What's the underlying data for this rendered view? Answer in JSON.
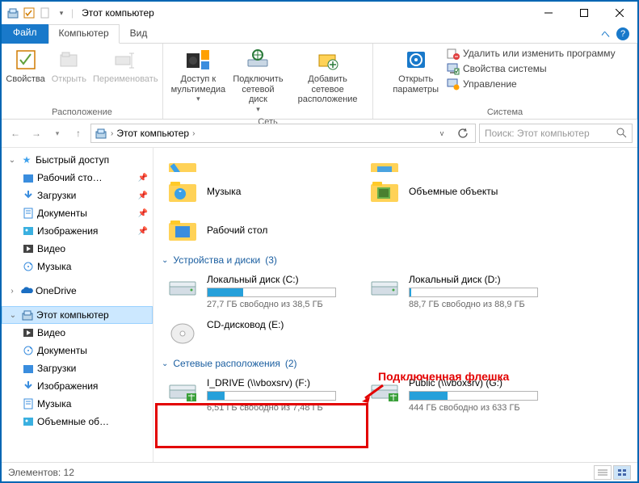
{
  "title": "Этот компьютер",
  "tabs": {
    "file": "Файл",
    "computer": "Компьютер",
    "view": "Вид"
  },
  "ribbon": {
    "group1": {
      "label": "Расположение",
      "props": "Свойства",
      "open": "Открыть",
      "rename": "Переименовать"
    },
    "group2": {
      "label": "Сеть",
      "media": "Доступ к\nмультимедиа",
      "netdrive": "Подключить\nсетевой диск",
      "addnet": "Добавить сетевое\nрасположение"
    },
    "group3": {
      "label": "Система",
      "settings": "Открыть\nпараметры",
      "uninstall": "Удалить или изменить программу",
      "sysprops": "Свойства системы",
      "manage": "Управление"
    }
  },
  "address": {
    "segment": "Этот компьютер"
  },
  "search": {
    "placeholder": "Поиск: Этот компьютер"
  },
  "tree": {
    "quick": "Быстрый доступ",
    "items1": [
      {
        "label": "Рабочий сто…",
        "pin": true
      },
      {
        "label": "Загрузки",
        "pin": true
      },
      {
        "label": "Документы",
        "pin": true
      },
      {
        "label": "Изображения",
        "pin": true
      },
      {
        "label": "Видео",
        "pin": false
      },
      {
        "label": "Музыка",
        "pin": false
      }
    ],
    "onedrive": "OneDrive",
    "thispc": "Этот компьютер",
    "items2": [
      {
        "label": "Видео"
      },
      {
        "label": "Документы"
      },
      {
        "label": "Загрузки"
      },
      {
        "label": "Изображения"
      },
      {
        "label": "Музыка"
      },
      {
        "label": "Объемные об…"
      }
    ]
  },
  "folders": {
    "row_partial": [
      {
        "name": ""
      },
      {
        "name": ""
      }
    ],
    "row1": [
      {
        "name": "Музыка"
      },
      {
        "name": "Объемные объекты"
      }
    ],
    "row2": [
      {
        "name": "Рабочий стол"
      }
    ]
  },
  "groups": {
    "devices": {
      "title": "Устройства и диски",
      "count": "(3)"
    },
    "network": {
      "title": "Сетевые расположения",
      "count": "(2)"
    }
  },
  "drives": [
    {
      "name": "Локальный диск (C:)",
      "free": "27,7 ГБ свободно из 38,5 ГБ",
      "pct": 28
    },
    {
      "name": "Локальный диск (D:)",
      "free": "88,7 ГБ свободно из 88,9 ГБ",
      "pct": 1
    },
    {
      "name": "CD-дисковод (E:)",
      "free": "",
      "pct": -1
    }
  ],
  "netdrives": [
    {
      "name": "I_DRIVE (\\\\vboxsrv) (F:)",
      "free": "6,51 ГБ свободно из 7,48 ГБ",
      "pct": 13
    },
    {
      "name": "Public (\\\\vboxsrv) (G:)",
      "free": "444 ГБ свободно из 633 ГБ",
      "pct": 30
    }
  ],
  "annotation": "Подключенная флешка",
  "status": {
    "count": "Элементов: 12"
  }
}
